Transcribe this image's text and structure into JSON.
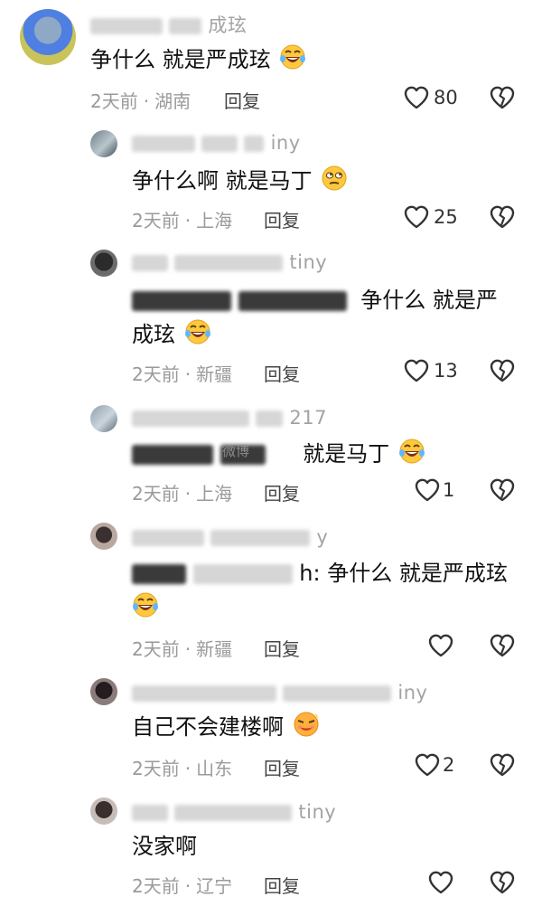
{
  "comments": [
    {
      "username_visible": "成玹",
      "text": "争什么 就是严成玹",
      "time": "2天前",
      "location": "湖南",
      "reply": "回复",
      "likes": "80"
    },
    {
      "username_visible": "iny",
      "text": "争什么啊 就是马丁",
      "time": "2天前",
      "location": "上海",
      "reply": "回复",
      "likes": "25"
    },
    {
      "username_visible": "tiny",
      "text_line1": "争什么 就是严",
      "text_line2": "成玹",
      "time": "2天前",
      "location": "新疆",
      "reply": "回复",
      "likes": "13"
    },
    {
      "username_visible": "217",
      "text": "就是马丁",
      "time": "2天前",
      "location": "上海",
      "reply": "回复",
      "likes": "1"
    },
    {
      "username_visible": "y",
      "text_line1": "h: 争什么 就是严成玹",
      "time": "2天前",
      "location": "新疆",
      "reply": "回复",
      "likes": ""
    },
    {
      "username_visible": "iny",
      "text": "自己不会建楼啊",
      "time": "2天前",
      "location": "山东",
      "reply": "回复",
      "likes": "2"
    },
    {
      "username_visible": "tiny",
      "text": "没家啊",
      "time": "2天前",
      "location": "辽宁",
      "reply": "回复",
      "likes": ""
    }
  ],
  "separator": "·",
  "watermark": "微博"
}
